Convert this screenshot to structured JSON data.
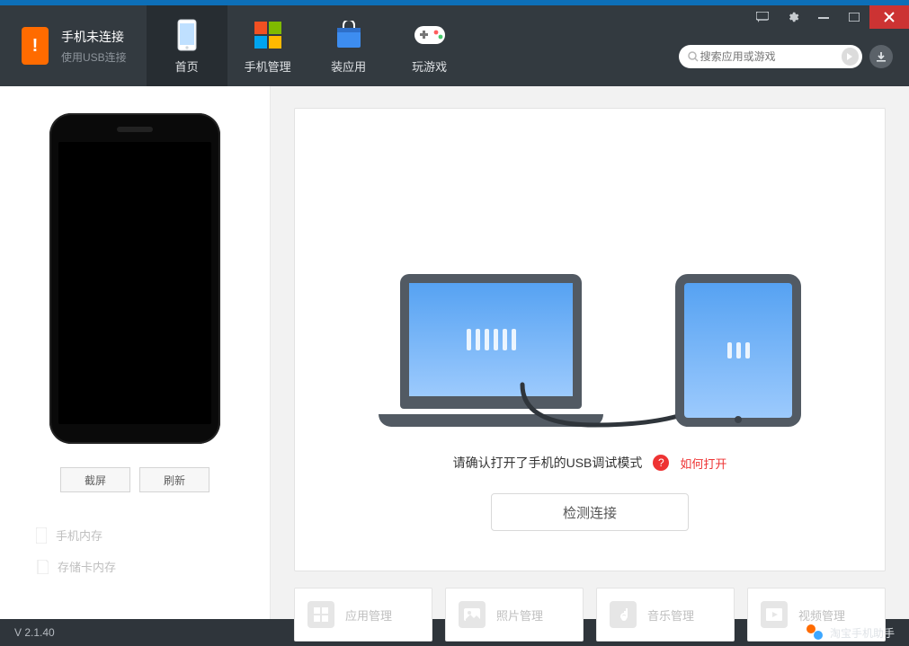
{
  "header": {
    "status_title": "手机未连接",
    "status_sub": "使用USB连接",
    "nav": [
      {
        "label": "首页"
      },
      {
        "label": "手机管理"
      },
      {
        "label": "装应用"
      },
      {
        "label": "玩游戏"
      }
    ],
    "active_nav_index": 0,
    "search_placeholder": "搜索应用或游戏"
  },
  "sidebar": {
    "btn_screenshot": "截屏",
    "btn_refresh": "刷新",
    "storage_phone": "手机内存",
    "storage_sd": "存储卡内存"
  },
  "main": {
    "usb_prompt": "请确认打开了手机的USB调试模式",
    "how_to_open": "如何打开",
    "detect_btn": "检测连接"
  },
  "tiles": [
    {
      "label": "应用管理"
    },
    {
      "label": "照片管理"
    },
    {
      "label": "音乐管理"
    },
    {
      "label": "视频管理"
    }
  ],
  "footer": {
    "version": "V 2.1.40",
    "brand": "淘宝手机助手"
  }
}
